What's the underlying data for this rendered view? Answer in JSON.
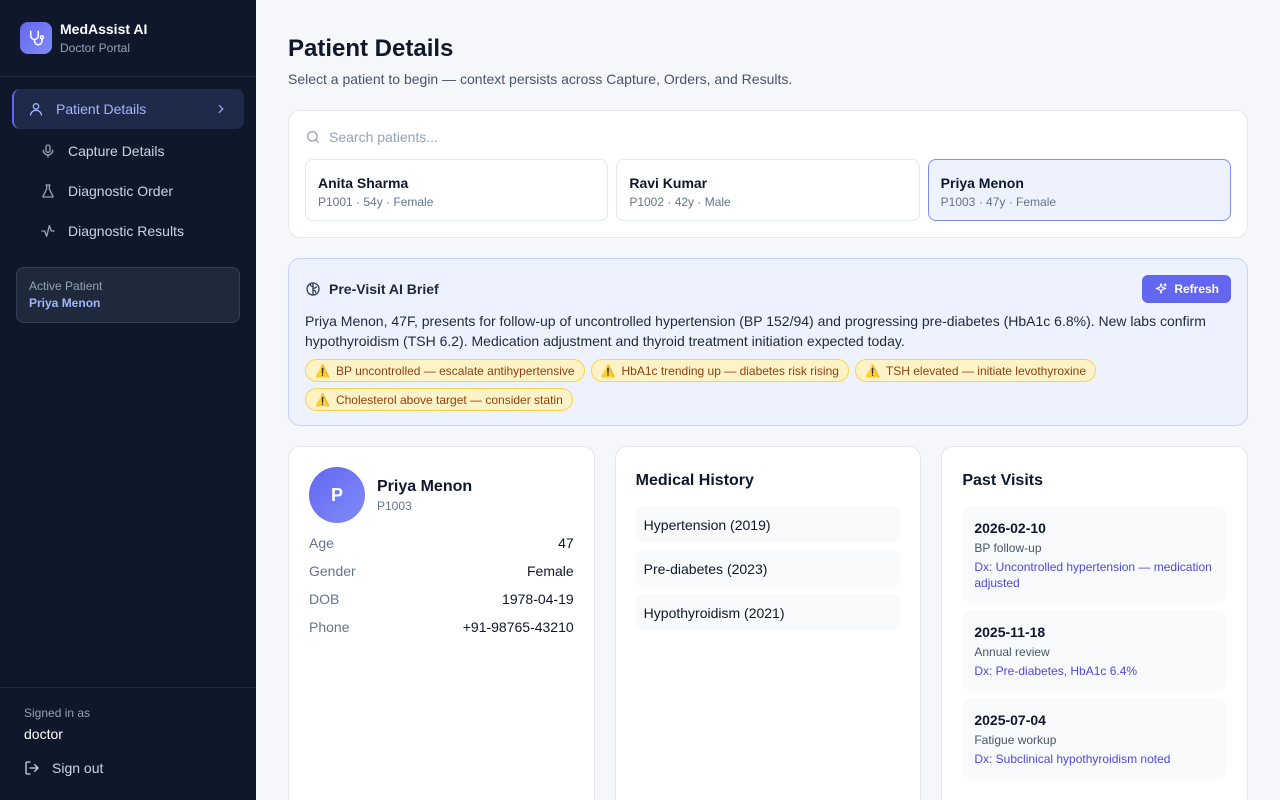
{
  "brand": {
    "title": "MedAssist AI",
    "subtitle": "Doctor Portal"
  },
  "sidebar": {
    "items": [
      {
        "label": "Patient Details",
        "icon": "user-icon",
        "active": true
      },
      {
        "label": "Capture Details",
        "icon": "mic-icon"
      },
      {
        "label": "Diagnostic Order",
        "icon": "flask-icon"
      },
      {
        "label": "Diagnostic Results",
        "icon": "activity-icon"
      }
    ],
    "active_patient": {
      "label": "Active Patient",
      "name": "Priya Menon"
    },
    "footer": {
      "signed_in_label": "Signed in as",
      "user": "doctor",
      "sign_out": "Sign out"
    }
  },
  "page": {
    "title": "Patient Details",
    "subtitle": "Select a patient to begin — context persists across Capture, Orders, and Results."
  },
  "search": {
    "placeholder": "Search patients...",
    "value": ""
  },
  "patients": [
    {
      "name": "Anita Sharma",
      "meta": "P1001 · 54y · Female"
    },
    {
      "name": "Ravi Kumar",
      "meta": "P1002 · 42y · Male"
    },
    {
      "name": "Priya Menon",
      "meta": "P1003 · 47y · Female",
      "selected": true
    }
  ],
  "brief": {
    "title": "Pre-Visit AI Brief",
    "refresh_label": "Refresh",
    "text": "Priya Menon, 47F, presents for follow-up of uncontrolled hypertension (BP 152/94) and progressing pre-diabetes (HbA1c 6.8%). New labs confirm hypothyroidism (TSH 6.2). Medication adjustment and thyroid treatment initiation expected today.",
    "flags": [
      "BP uncontrolled — escalate antihypertensive",
      "HbA1c trending up — diabetes risk rising",
      "TSH elevated — initiate levothyroxine",
      "Cholesterol above target — consider statin"
    ]
  },
  "profile": {
    "initial": "P",
    "name": "Priya Menon",
    "id": "P1003",
    "fields": [
      {
        "k": "Age",
        "v": "47"
      },
      {
        "k": "Gender",
        "v": "Female"
      },
      {
        "k": "DOB",
        "v": "1978-04-19"
      },
      {
        "k": "Phone",
        "v": "+91-98765-43210"
      }
    ]
  },
  "history": {
    "title": "Medical History",
    "items": [
      "Hypertension (2019)",
      "Pre-diabetes (2023)",
      "Hypothyroidism (2021)"
    ]
  },
  "visits": {
    "title": "Past Visits",
    "items": [
      {
        "date": "2026-02-10",
        "reason": "BP follow-up",
        "dx": "Dx: Uncontrolled hypertension — medication adjusted"
      },
      {
        "date": "2025-11-18",
        "reason": "Annual review",
        "dx": "Dx: Pre-diabetes, HbA1c 6.4%"
      },
      {
        "date": "2025-07-04",
        "reason": "Fatigue workup",
        "dx": "Dx: Subclinical hypothyroidism noted"
      }
    ]
  },
  "colors": {
    "accent": "#6366f1",
    "sidebar_bg": "#0f172a",
    "brief_bg": "#eef2ff",
    "flag_bg": "#fef3c7"
  }
}
